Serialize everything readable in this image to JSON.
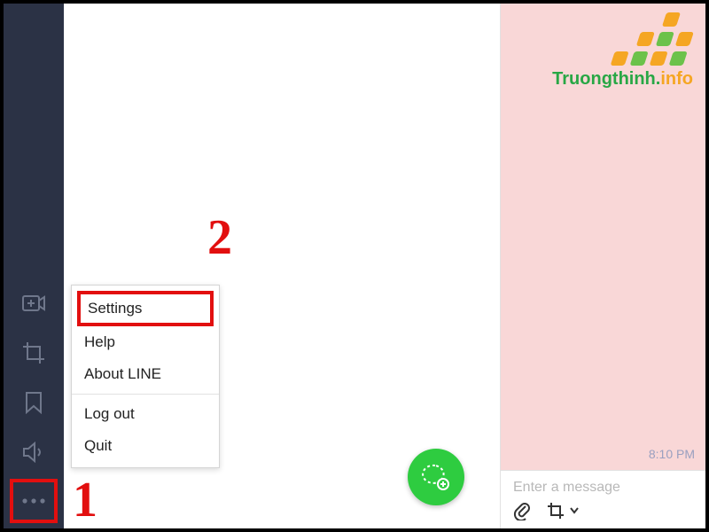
{
  "sidebar": {
    "icons": [
      "add-video-icon",
      "crop-icon",
      "bookmark-icon",
      "speaker-icon"
    ],
    "more_label": "more-icon"
  },
  "menu": {
    "items": [
      {
        "label": "Settings",
        "highlight": true
      },
      {
        "label": "Help",
        "highlight": false
      },
      {
        "label": "About LINE",
        "highlight": false
      }
    ],
    "items2": [
      {
        "label": "Log out"
      },
      {
        "label": "Quit"
      }
    ]
  },
  "chat": {
    "timestamp": "8:10 PM",
    "placeholder": "Enter a message"
  },
  "watermark": {
    "part1": "Truongthinh",
    "dot": ".",
    "part2": "info"
  },
  "annotations": {
    "step1": "1",
    "step2": "2"
  }
}
